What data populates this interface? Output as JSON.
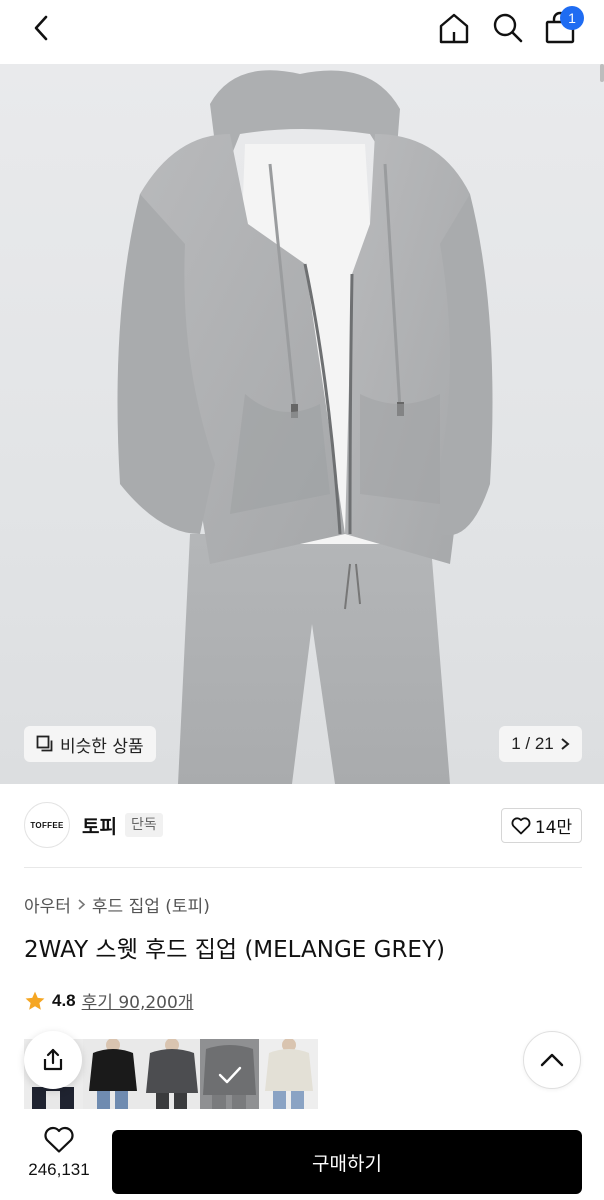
{
  "header": {
    "back_icon": "chevron-left-icon",
    "home_icon": "home-icon",
    "search_icon": "search-icon",
    "cart_icon": "shopping-bag-icon",
    "cart_count": "1",
    "badge_color": "#1f6cf2"
  },
  "hero": {
    "similar_label": "비슷한 상품",
    "similar_icon": "copy-icon",
    "counter": "1 / 21",
    "counter_icon": "chevron-right-icon"
  },
  "brand": {
    "logo_text": "TOFFEE",
    "name": "토피",
    "badge": "단독",
    "likes": "14만",
    "like_icon": "heart-outline-icon"
  },
  "breadcrumb": {
    "category": "아우터",
    "subcategory": "후드 집업 (토피)",
    "separator_icon": "chevron-right-icon"
  },
  "product": {
    "title": "2WAY 스웻 후드 집업 (MELANGE GREY)",
    "rating": "4.8",
    "reviews": "후기 90,200개",
    "star_color": "#f5a623"
  },
  "thumbnails": [
    {
      "color": "navy-black"
    },
    {
      "color": "black"
    },
    {
      "color": "charcoal"
    },
    {
      "color": "grey",
      "selected": true
    },
    {
      "color": "ivory"
    }
  ],
  "actions": {
    "share_icon": "share-icon",
    "top_icon": "chevron-up-icon"
  },
  "bottom": {
    "wish_icon": "heart-outline-icon",
    "wish_count": "246,131",
    "buy_label": "구매하기"
  }
}
